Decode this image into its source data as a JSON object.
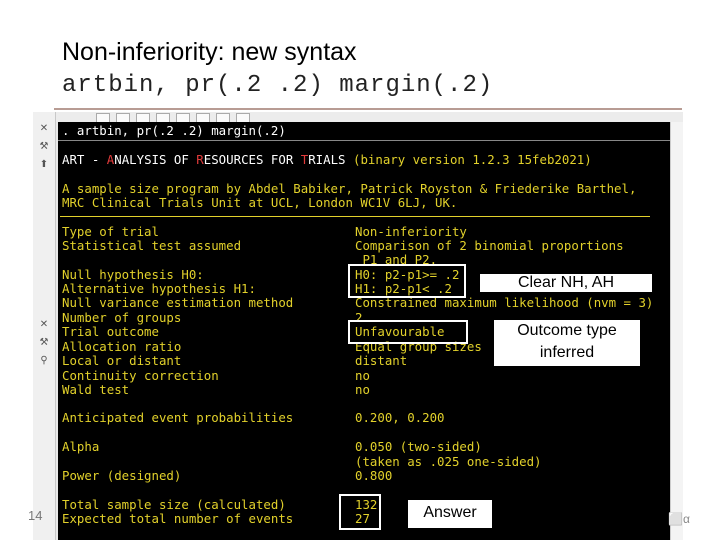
{
  "slide": {
    "title": "Non-inferiority: new syntax",
    "command": "artbin, pr(.2 .2) margin(.2)",
    "page_number": "14",
    "logo_text": "⬜α"
  },
  "console": {
    "command_line": ". artbin, pr(.2 .2) margin(.2)",
    "header_prefix": "ART - ",
    "header_a": "A",
    "header_nalysis": "NALYSIS OF ",
    "header_r": "R",
    "header_esources": "ESOURCES FOR ",
    "header_t": "T",
    "header_rials": "RIALS",
    "header_version": " (binary version 1.2.3 15feb2021)",
    "credit1": "A sample size program by Abdel Babiker, Patrick Royston & Friederike Barthel,",
    "credit2": "MRC Clinical Trials Unit at UCL, London WC1V 6LJ, UK.",
    "rows": [
      {
        "label": "Type of trial",
        "value": "Non-inferiority"
      },
      {
        "label": "Statistical test assumed",
        "value": "Comparison of 2 binomial proportions"
      },
      {
        "label": "",
        "value": " P1 and P2."
      },
      {
        "label": "Null hypothesis H0:",
        "value": "H0: p2-p1>= .2"
      },
      {
        "label": "Alternative hypothesis H1:",
        "value": "H1: p2-p1< .2"
      },
      {
        "label": "Null variance estimation method",
        "value": "Constrained maximum likelihood (nvm = 3)"
      },
      {
        "label": "Number of groups",
        "value": "2"
      },
      {
        "label": "Trial outcome",
        "value": "Unfavourable"
      },
      {
        "label": "Allocation ratio",
        "value": "Equal group sizes"
      },
      {
        "label": "Local or distant",
        "value": "distant"
      },
      {
        "label": "Continuity correction",
        "value": "no"
      },
      {
        "label": "Wald test",
        "value": "no"
      }
    ],
    "anticipated_label": "Anticipated event probabilities",
    "anticipated_value": "0.200, 0.200",
    "alpha_label": "Alpha",
    "alpha_value": "0.050 (two-sided)",
    "alpha_value2": "(taken as .025 one-sided)",
    "power_label": "Power (designed)",
    "power_value": "0.800",
    "total_label": "Total sample size (calculated)",
    "total_value": "132",
    "events_label": "Expected total number of events",
    "events_value": "27"
  },
  "annotations": {
    "nh_ah": "Clear NH, AH",
    "outcome_line1": "Outcome type",
    "outcome_line2": "inferred",
    "answer": "Answer"
  },
  "icons": [
    "close-icon",
    "wrench-icon",
    "up-arrow-icon",
    "close-icon",
    "wrench-icon",
    "pin-icon"
  ],
  "colors": {
    "console_bg": "#000000",
    "console_text": "#e2d12b",
    "console_command": "#ffffff",
    "header_highlight": "#e23b3b",
    "rule": "#b89c94"
  }
}
